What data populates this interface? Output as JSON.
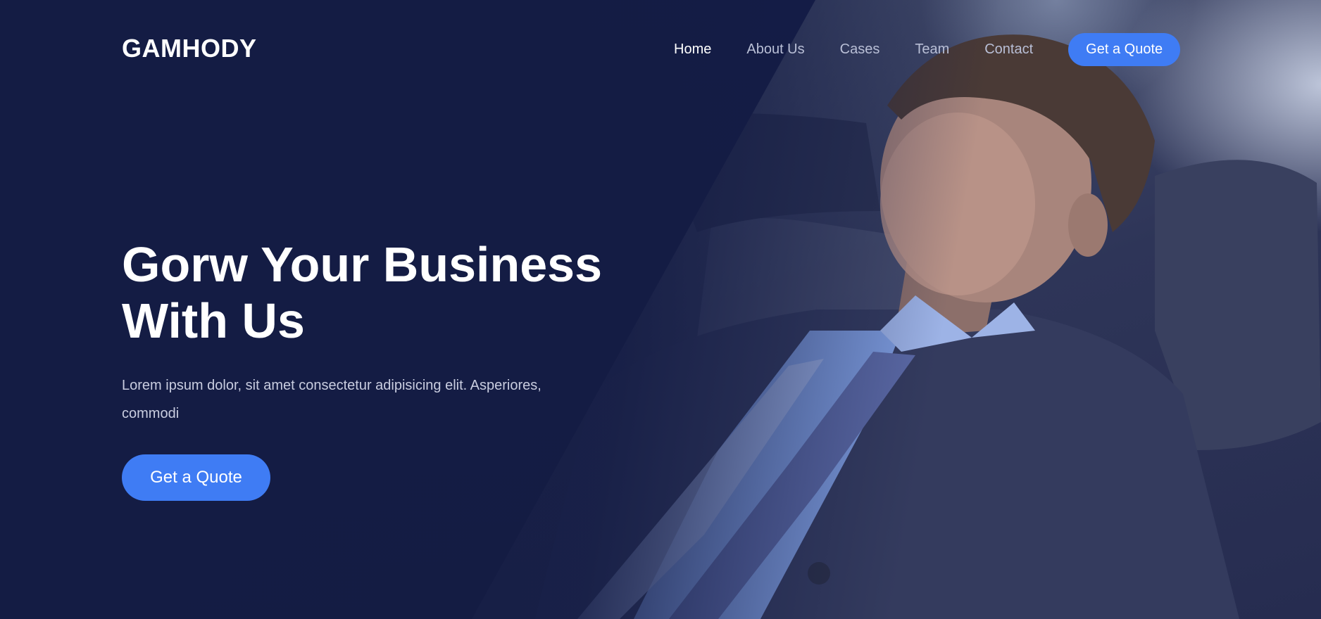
{
  "brand": {
    "logo": "GAMHODY"
  },
  "nav": {
    "items": [
      {
        "label": "Home",
        "active": true
      },
      {
        "label": "About Us",
        "active": false
      },
      {
        "label": "Cases",
        "active": false
      },
      {
        "label": "Team",
        "active": false
      },
      {
        "label": "Contact",
        "active": false
      }
    ],
    "cta_label": "Get a Quote"
  },
  "hero": {
    "headline_line1": "Gorw Your Business",
    "headline_line2": "With Us",
    "lead": "Lorem ipsum dolor, sit amet consectetur adipisicing elit. Asperiores, commodi",
    "cta_label": "Get a Quote",
    "image": "businessman-relaxing-photo"
  },
  "colors": {
    "background": "#141c44",
    "accent": "#3f7cf4",
    "text": "#ffffff",
    "muted_text": "#b9bfd6"
  }
}
